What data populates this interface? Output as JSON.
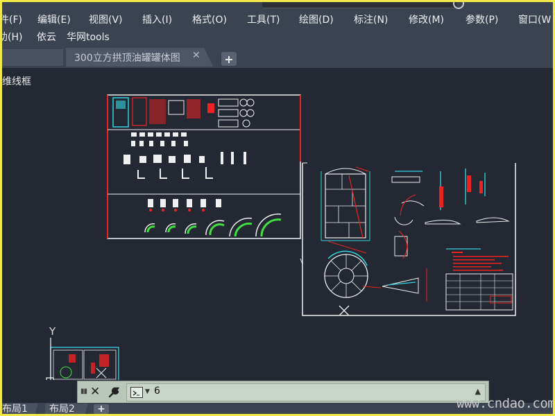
{
  "menu": {
    "row1": [
      "件(F)",
      "编辑(E)",
      "视图(V)",
      "插入(I)",
      "格式(O)",
      "工具(T)",
      "绘图(D)",
      "标注(N)",
      "修改(M)",
      "参数(P)",
      "窗口(W"
    ],
    "row2": [
      "助(H)",
      "依云",
      "华网tools"
    ]
  },
  "tabs": {
    "document": "300立方拱顶油罐罐体图",
    "close_glyph": "✕",
    "add_glyph": "+"
  },
  "viewport": {
    "label": "维线框"
  },
  "axis": {
    "y_label": "Y"
  },
  "command": {
    "text": "6",
    "close_glyph": "✕",
    "scroll_glyph": "▲"
  },
  "layouts": {
    "tab1": "布局1",
    "tab2": "布局2",
    "add_glyph": "+"
  },
  "watermark": "www.cndao.com",
  "colors": {
    "background": "#232832",
    "cyan": "#33d6e0",
    "red": "#ee2222",
    "white": "#f0f0f0",
    "green": "#44dd44",
    "yellow": "#f5e94a"
  }
}
